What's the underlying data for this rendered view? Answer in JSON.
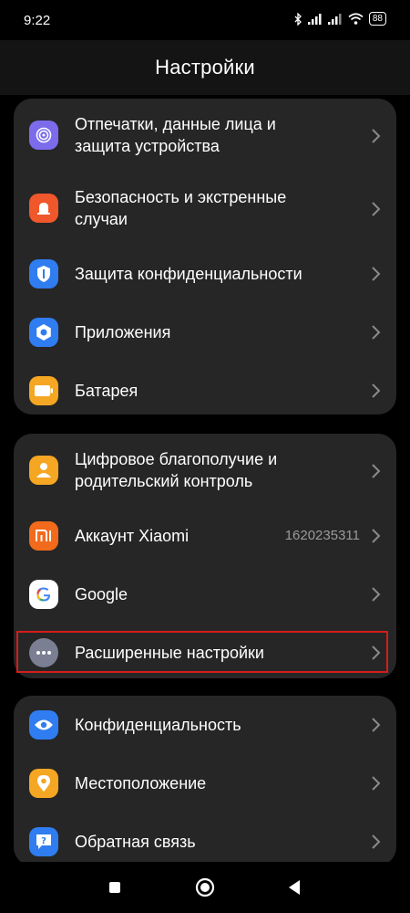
{
  "status": {
    "time": "9:22",
    "battery": "88",
    "icons": [
      "bluetooth-icon",
      "signal-icon",
      "signal-icon",
      "wifi-icon",
      "battery-icon"
    ]
  },
  "header": {
    "title": "Настройки"
  },
  "sections": [
    {
      "items": [
        {
          "id": "fingerprints",
          "label_line1": "Отпечатки, данные лица и",
          "label_line2": "защита устройства",
          "icon": "fingerprint-icon",
          "icon_color": "#7C6CEB"
        },
        {
          "id": "security",
          "label_line1": "Безопасность и экстренные",
          "label_line2": "случаи",
          "icon": "emergency-icon",
          "icon_color": "#F0572A"
        },
        {
          "id": "privacy-protection",
          "label_line1": "Защита конфиденциальности",
          "icon": "shield-icon",
          "icon_color": "#2F7DF0"
        },
        {
          "id": "apps",
          "label_line1": "Приложения",
          "icon": "apps-gear-icon",
          "icon_color": "#2F7DF0"
        },
        {
          "id": "battery",
          "label_line1": "Батарея",
          "icon": "battery-icon",
          "icon_color": "#F5A623"
        }
      ]
    },
    {
      "items": [
        {
          "id": "wellbeing",
          "label_line1": "Цифровое благополучие и",
          "label_line2": "родительский контроль",
          "icon": "person-icon",
          "icon_color": "#F5A623"
        },
        {
          "id": "xiaomi-account",
          "label_line1": "Аккаунт Xiaomi",
          "value": "1620235311",
          "icon": "mi-logo-icon",
          "icon_color": "#F26A1B"
        },
        {
          "id": "google",
          "label_line1": "Google",
          "icon": "google-icon",
          "icon_color": "#FFFFFF"
        },
        {
          "id": "advanced",
          "label_line1": "Расширенные настройки",
          "icon": "more-dots-icon",
          "icon_color": "#7B7F93"
        }
      ]
    },
    {
      "items": [
        {
          "id": "privacy",
          "label_line1": "Конфиденциальность",
          "icon": "eye-icon",
          "icon_color": "#2F7DF0"
        },
        {
          "id": "location",
          "label_line1": "Местоположение",
          "icon": "location-icon",
          "icon_color": "#F5A623"
        },
        {
          "id": "feedback",
          "label_line1": "Обратная связь",
          "icon": "feedback-icon",
          "icon_color": "#2F7DF0"
        }
      ]
    }
  ],
  "colors": {
    "background": "#000000",
    "card": "#262626",
    "header": "#141414",
    "highlight": "#D61C1C",
    "secondary_text": "#9A9A9A"
  },
  "navbar": {
    "buttons": [
      "recents-button",
      "home-button",
      "back-button"
    ]
  }
}
